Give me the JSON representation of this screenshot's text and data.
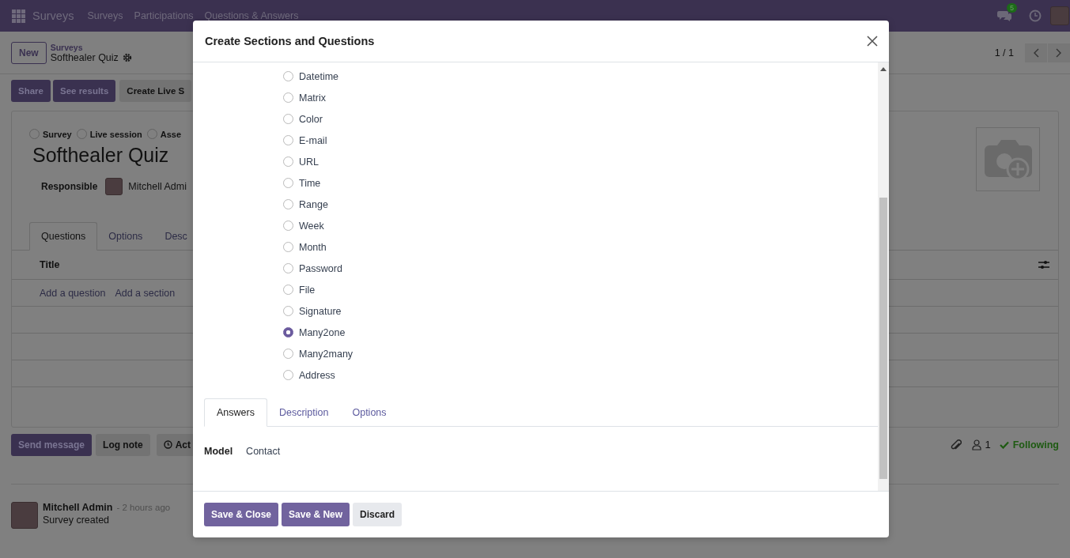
{
  "navbar": {
    "app": "Surveys",
    "menu": [
      "Surveys",
      "Participations",
      "Questions & Answers"
    ],
    "chat_badge": "5"
  },
  "control_panel": {
    "new_button": "New",
    "breadcrumb_parent": "Surveys",
    "breadcrumb_current": "Softhealer Quiz",
    "pager": "1 / 1"
  },
  "actions": [
    {
      "label": "Share",
      "kind": "primary"
    },
    {
      "label": "See results",
      "kind": "primary"
    },
    {
      "label": "Create Live S",
      "kind": "secondary"
    }
  ],
  "form": {
    "survey_type": [
      {
        "label": "Survey",
        "selected": false
      },
      {
        "label": "Live session",
        "selected": false
      },
      {
        "label": "Asse",
        "selected": false
      }
    ],
    "title": "Softhealer Quiz",
    "responsible_label": "Responsible",
    "responsible": "Mitchell Admi",
    "tabs": [
      {
        "label": "Questions",
        "selected": true
      },
      {
        "label": "Options",
        "selected": false
      },
      {
        "label": "Desc",
        "selected": false
      }
    ],
    "table": {
      "columns": [
        "Title"
      ],
      "add_links": [
        "Add a question",
        "Add a section"
      ]
    }
  },
  "chatter": {
    "buttons": [
      {
        "label": "Send message",
        "kind": "primary"
      },
      {
        "label": "Log note",
        "kind": "secondary"
      },
      {
        "label": "Act",
        "kind": "activity"
      }
    ],
    "followers_count": "1",
    "follow_status": "Following",
    "messages": [
      {
        "author": "Mitchell Admin",
        "time": "- 2 hours ago",
        "body": "Survey created"
      }
    ]
  },
  "dialog": {
    "title": "Create Sections and Questions",
    "question_types": [
      {
        "label": "Datetime",
        "selected": false
      },
      {
        "label": "Matrix",
        "selected": false
      },
      {
        "label": "Color",
        "selected": false
      },
      {
        "label": "E-mail",
        "selected": false
      },
      {
        "label": "URL",
        "selected": false
      },
      {
        "label": "Time",
        "selected": false
      },
      {
        "label": "Range",
        "selected": false
      },
      {
        "label": "Week",
        "selected": false
      },
      {
        "label": "Month",
        "selected": false
      },
      {
        "label": "Password",
        "selected": false
      },
      {
        "label": "File",
        "selected": false
      },
      {
        "label": "Signature",
        "selected": false
      },
      {
        "label": "Many2one",
        "selected": true
      },
      {
        "label": "Many2many",
        "selected": false
      },
      {
        "label": "Address",
        "selected": false
      }
    ],
    "tabs": [
      {
        "label": "Answers",
        "selected": true
      },
      {
        "label": "Description",
        "selected": false
      },
      {
        "label": "Options",
        "selected": false
      }
    ],
    "fields": [
      {
        "label": "Model",
        "value": "Contact"
      }
    ],
    "buttons": [
      {
        "label": "Save & Close",
        "kind": "primary"
      },
      {
        "label": "Save & New",
        "kind": "primary"
      },
      {
        "label": "Discard",
        "kind": "secondary"
      }
    ]
  }
}
